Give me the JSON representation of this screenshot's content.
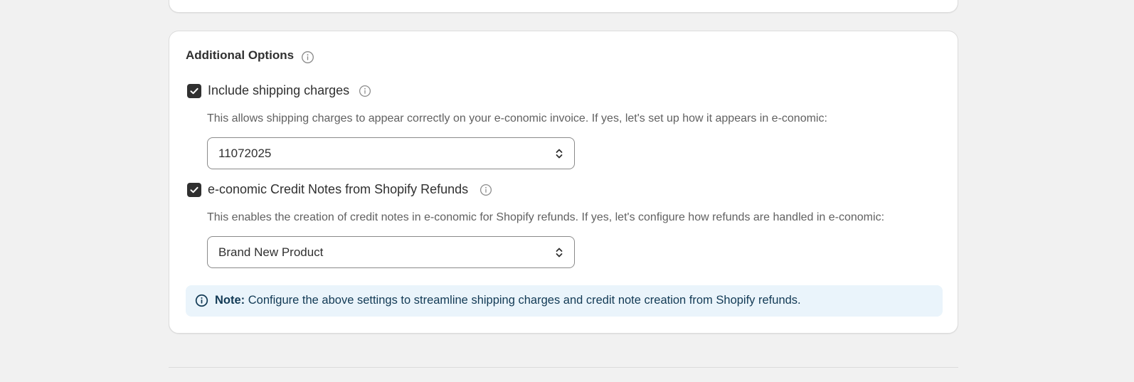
{
  "section": {
    "title": "Additional Options"
  },
  "options": [
    {
      "label": "Include shipping charges",
      "checked": true,
      "help": "This allows shipping charges to appear correctly on your e-conomic invoice. If yes, let's set up how it appears in e-conomic:",
      "select_value": "11072025"
    },
    {
      "label": "e-conomic Credit Notes from Shopify Refunds",
      "checked": true,
      "help": "This enables the creation of credit notes in e-conomic for Shopify refunds. If yes, let's configure how refunds are handled in e-conomic:",
      "select_value": "Brand New Product"
    }
  ],
  "note": {
    "label": "Note:",
    "text": "Configure the above settings to streamline shipping charges and credit note creation from Shopify refunds."
  },
  "icons": {
    "section_info": "info-icon",
    "option_info": "info-icon",
    "checkbox_check": "checkmark-icon",
    "select_chevron": "chevron-up-down-icon",
    "note_info": "info-icon"
  },
  "colors": {
    "page_bg": "#f1f1f1",
    "card_bg": "#ffffff",
    "checkbox_bg": "#303030",
    "note_bg": "#eaf4fb",
    "note_text": "#123a55"
  }
}
